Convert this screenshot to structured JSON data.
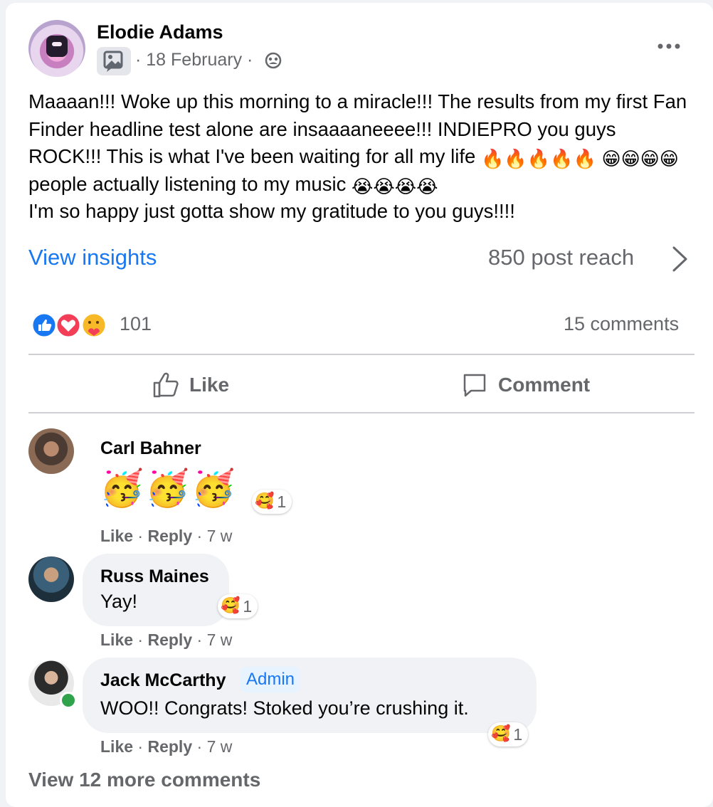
{
  "post": {
    "author": "Elodie Adams",
    "date": "18 February",
    "sep1": "·",
    "sep2": "·",
    "text_1": "Maaaan!!! Woke up this morning to a miracle!!! The results from my first Fan Finder headline test alone are insaaaaneeee!!! INDIEPRO you guys ROCK!!! This is what I've been waiting for all my life ",
    "emoji_fire": "🔥🔥🔥🔥🔥",
    "emoji_grin": "😁😁😁😁",
    "text_2": " people actually listening to my music ",
    "emoji_cry": "😭😭😭😭",
    "text_3": "I'm so happy just gotta show my gratitude to you guys!!!!",
    "view_insights": "View insights",
    "reach": "850 post reach",
    "reaction_count": "101",
    "comments_count": "15 comments",
    "like_label": "Like",
    "comment_label": "Comment",
    "icons": [
      "photo-icon",
      "globe-icon",
      "more-icon",
      "chevron-right-icon",
      "like-icon",
      "comment-icon"
    ]
  },
  "colors": {
    "link_blue": "#1877f2",
    "secondary_text": "#65676b",
    "online_green": "#31a24c",
    "bubble_bg": "#f0f2f5"
  },
  "comments": [
    {
      "name": "Carl Bahner",
      "body": "🥳🥳🥳",
      "reaction_emoji": "🥰",
      "reaction_count": "1",
      "like": "Like",
      "reply": "Reply",
      "sep1": "·",
      "sep2": "·",
      "time": "7 w"
    },
    {
      "name": "Russ Maines",
      "body": "Yay!",
      "reaction_emoji": "🥰",
      "reaction_count": "1",
      "like": "Like",
      "reply": "Reply",
      "sep1": "·",
      "sep2": "·",
      "time": "7 w"
    },
    {
      "name": "Jack McCarthy",
      "badge": "Admin",
      "body": "WOO!! Congrats! Stoked you’re crushing it.",
      "reaction_emoji": "🥰",
      "reaction_count": "1",
      "like": "Like",
      "reply": "Reply",
      "sep1": "·",
      "sep2": "·",
      "time": "7 w"
    }
  ],
  "view_more": "View 12 more comments"
}
